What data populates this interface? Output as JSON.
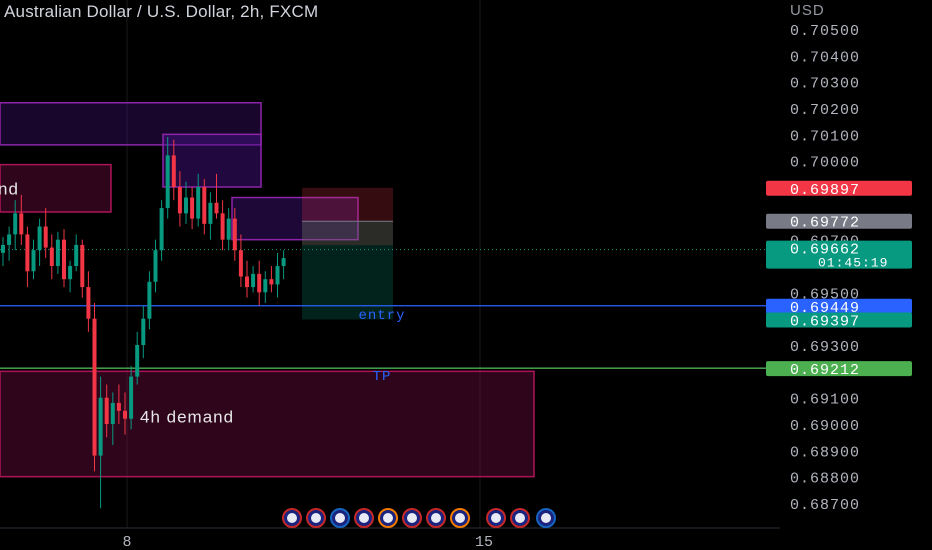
{
  "header": {
    "title": "Australian Dollar / U.S. Dollar, 2h, FXCM",
    "currency": "USD"
  },
  "chart_data": {
    "type": "candlestick",
    "price_axis": {
      "labels": [
        "0.70500",
        "0.70400",
        "0.70300",
        "0.70200",
        "0.70100",
        "0.70000",
        "0.69700",
        "0.69500",
        "0.69300",
        "0.69100",
        "0.69000",
        "0.68900",
        "0.68800",
        "0.68700"
      ],
      "values": [
        0.705,
        0.704,
        0.703,
        0.702,
        0.701,
        0.7,
        0.697,
        0.695,
        0.693,
        0.691,
        0.69,
        0.689,
        0.688,
        0.687
      ],
      "range": [
        0.6863,
        0.7056
      ]
    },
    "time_axis": {
      "labels": [
        "8",
        "15"
      ]
    },
    "price_tags": [
      {
        "name": "red-tag",
        "text": "0.69897",
        "value": 0.69897,
        "color": "#f23645"
      },
      {
        "name": "gray-tag",
        "text": "0.69772",
        "value": 0.69772,
        "color": "#787b86"
      },
      {
        "name": "last-price-tag",
        "text": "0.69662",
        "countdown": "01:45:19",
        "value": 0.69662,
        "color": "#089981"
      },
      {
        "name": "entry-tag",
        "text": "0.69449",
        "value": 0.69449,
        "color": "#2962ff"
      },
      {
        "name": "stop-tag",
        "text": "0.69397",
        "value": 0.69397,
        "color": "#089981"
      },
      {
        "name": "tp-tag",
        "text": "0.69212",
        "value": 0.69212,
        "color": "#4caf50"
      }
    ],
    "lines": [
      {
        "name": "entry-line",
        "label": "entry",
        "value": 0.69449,
        "color": "#2962ff"
      },
      {
        "name": "tp-line",
        "label": "TP",
        "value": 0.69212,
        "color": "#4caf50"
      }
    ],
    "zones": [
      {
        "name": "top-supply-zone",
        "top": 0.7022,
        "bottom": 0.7006,
        "color": "#9c27b0",
        "label": ""
      },
      {
        "name": "supply-zone-inner",
        "top": 0.701,
        "bottom": 0.699,
        "color": "#9c27b0",
        "label": ""
      },
      {
        "name": "left-demand-zone",
        "top": 0.69985,
        "bottom": 0.69805,
        "color": "#e91e63",
        "label": "nd"
      },
      {
        "name": "small-supply-zone",
        "top": 0.6986,
        "bottom": 0.697,
        "color": "#9c27b0",
        "label": ""
      },
      {
        "name": "h4-demand-zone",
        "top": 0.692,
        "bottom": 0.688,
        "color": "#e91e63",
        "label": "4h demand"
      }
    ],
    "position": {
      "entry": 0.69449,
      "stop": 0.69897,
      "target": 0.69397
    },
    "candles": [
      [
        0.6965,
        0.6971,
        0.696,
        0.6968
      ],
      [
        0.6968,
        0.6975,
        0.6962,
        0.6972
      ],
      [
        0.6972,
        0.6985,
        0.6966,
        0.698
      ],
      [
        0.698,
        0.6987,
        0.6968,
        0.6972
      ],
      [
        0.6972,
        0.6975,
        0.6952,
        0.6958
      ],
      [
        0.6958,
        0.697,
        0.6955,
        0.6966
      ],
      [
        0.6966,
        0.6978,
        0.696,
        0.6975
      ],
      [
        0.6975,
        0.6982,
        0.6963,
        0.6967
      ],
      [
        0.6967,
        0.6972,
        0.6955,
        0.696
      ],
      [
        0.696,
        0.6973,
        0.6957,
        0.697
      ],
      [
        0.697,
        0.6974,
        0.6952,
        0.6955
      ],
      [
        0.6955,
        0.6962,
        0.695,
        0.696
      ],
      [
        0.696,
        0.6972,
        0.6958,
        0.6968
      ],
      [
        0.6968,
        0.697,
        0.6948,
        0.6952
      ],
      [
        0.6952,
        0.6958,
        0.6935,
        0.694
      ],
      [
        0.694,
        0.6946,
        0.6882,
        0.6888
      ],
      [
        0.6888,
        0.6918,
        0.6868,
        0.691
      ],
      [
        0.691,
        0.6915,
        0.6895,
        0.69
      ],
      [
        0.69,
        0.6912,
        0.6892,
        0.6908
      ],
      [
        0.6908,
        0.6915,
        0.69,
        0.6905
      ],
      [
        0.6905,
        0.6912,
        0.6896,
        0.6902
      ],
      [
        0.6902,
        0.6922,
        0.6898,
        0.6918
      ],
      [
        0.6918,
        0.6935,
        0.6915,
        0.693
      ],
      [
        0.693,
        0.6945,
        0.6925,
        0.694
      ],
      [
        0.694,
        0.6958,
        0.6936,
        0.6954
      ],
      [
        0.6954,
        0.697,
        0.695,
        0.6966
      ],
      [
        0.6966,
        0.6985,
        0.6962,
        0.6982
      ],
      [
        0.6982,
        0.7009,
        0.6978,
        0.7002
      ],
      [
        0.7002,
        0.7008,
        0.6985,
        0.699
      ],
      [
        0.699,
        0.6996,
        0.6975,
        0.698
      ],
      [
        0.698,
        0.6992,
        0.6976,
        0.6986
      ],
      [
        0.6986,
        0.699,
        0.6974,
        0.6978
      ],
      [
        0.6978,
        0.6995,
        0.6975,
        0.699
      ],
      [
        0.699,
        0.6993,
        0.6972,
        0.6976
      ],
      [
        0.6976,
        0.6988,
        0.697,
        0.6984
      ],
      [
        0.6984,
        0.6995,
        0.6978,
        0.698
      ],
      [
        0.698,
        0.6985,
        0.6966,
        0.697
      ],
      [
        0.697,
        0.6982,
        0.6966,
        0.6978
      ],
      [
        0.6978,
        0.6982,
        0.6962,
        0.6966
      ],
      [
        0.6966,
        0.6972,
        0.6952,
        0.6956
      ],
      [
        0.6956,
        0.6962,
        0.6948,
        0.6952
      ],
      [
        0.6952,
        0.696,
        0.695,
        0.6957
      ],
      [
        0.6957,
        0.6962,
        0.6945,
        0.695
      ],
      [
        0.695,
        0.6958,
        0.6946,
        0.6955
      ],
      [
        0.6955,
        0.696,
        0.695,
        0.6953
      ],
      [
        0.6953,
        0.6965,
        0.6948,
        0.696
      ],
      [
        0.696,
        0.6966,
        0.6955,
        0.6963
      ]
    ]
  }
}
